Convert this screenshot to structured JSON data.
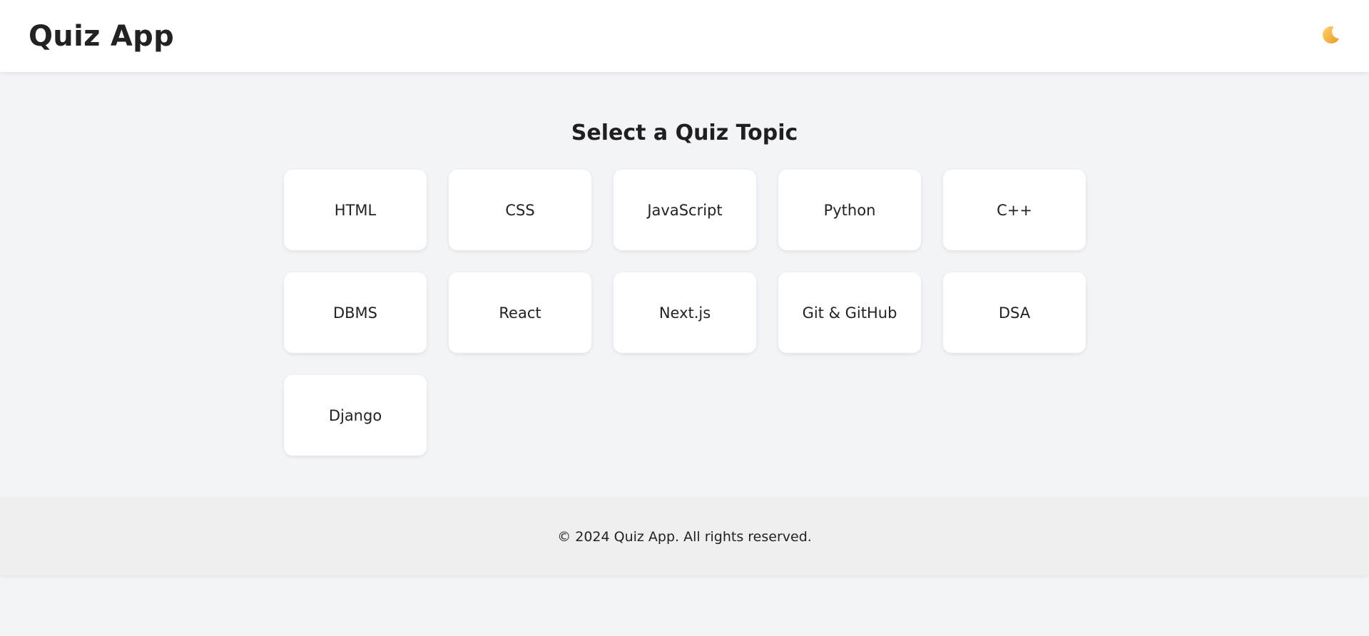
{
  "header": {
    "title": "Quiz App",
    "theme_toggle_icon": "moon-icon"
  },
  "main": {
    "heading": "Select a Quiz Topic",
    "topics": [
      {
        "label": "HTML"
      },
      {
        "label": "CSS"
      },
      {
        "label": "JavaScript"
      },
      {
        "label": "Python"
      },
      {
        "label": "C++"
      },
      {
        "label": "DBMS"
      },
      {
        "label": "React"
      },
      {
        "label": "Next.js"
      },
      {
        "label": "Git & GitHub"
      },
      {
        "label": "DSA"
      },
      {
        "label": "Django"
      }
    ]
  },
  "footer": {
    "text": "© 2024 Quiz App. All rights reserved."
  },
  "colors": {
    "page_background": "#f3f4f8",
    "header_background": "#ffffff",
    "card_background": "#ffffff",
    "footer_background": "#efefef",
    "moon": "#f4b942"
  }
}
